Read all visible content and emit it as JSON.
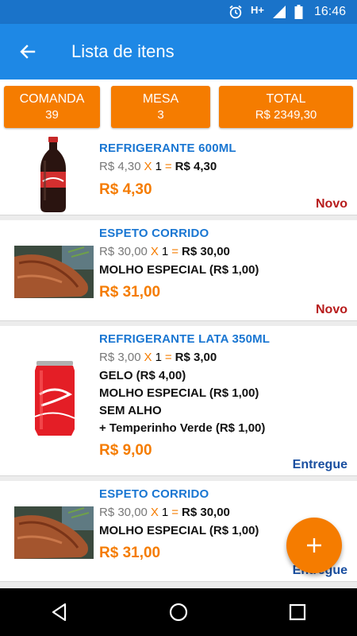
{
  "status_bar": {
    "time": "16:46",
    "network": "H+"
  },
  "app_bar": {
    "title": "Lista de itens"
  },
  "summary": {
    "comanda_label": "COMANDA",
    "comanda_value": "39",
    "mesa_label": "MESA",
    "mesa_value": "3",
    "total_label": "TOTAL",
    "total_value": "R$ 2349,30"
  },
  "items": [
    {
      "name": "REFRIGERANTE 600ML",
      "unit_price": "R$ 4,30",
      "times": "X",
      "qty": "1",
      "equals": "=",
      "line_total": "R$ 4,30",
      "extras": [],
      "price": "R$ 4,30",
      "status": "Novo",
      "image": "soda-bottle"
    },
    {
      "name": "ESPETO CORRIDO",
      "unit_price": "R$ 30,00",
      "times": "X",
      "qty": "1",
      "equals": "=",
      "line_total": "R$ 30,00",
      "extras": [
        "MOLHO ESPECIAL (R$ 1,00)"
      ],
      "price": "R$ 31,00",
      "status": "Novo",
      "image": "grilled-meat"
    },
    {
      "name": "REFRIGERANTE LATA 350ML",
      "unit_price": "R$ 3,00",
      "times": "X",
      "qty": "1",
      "equals": "=",
      "line_total": "R$ 3,00",
      "extras": [
        "GELO (R$ 4,00)",
        "MOLHO ESPECIAL (R$ 1,00)",
        "SEM ALHO",
        "+ Temperinho Verde (R$ 1,00)"
      ],
      "price": "R$ 9,00",
      "status": "Entregue",
      "image": "soda-can"
    },
    {
      "name": "ESPETO CORRIDO",
      "unit_price": "R$ 30,00",
      "times": "X",
      "qty": "1",
      "equals": "=",
      "line_total": "R$ 30,00",
      "extras": [
        "MOLHO ESPECIAL (R$ 1,00)"
      ],
      "price": "R$ 31,00",
      "status": "Entregue",
      "image": "grilled-meat"
    }
  ],
  "colors": {
    "primary": "#1e88e5",
    "status_bar": "#1a73c9",
    "accent": "#f57c00",
    "novo": "#b71c1c",
    "entregue": "#1a4fa0",
    "item_name": "#1976d2"
  },
  "icons": {
    "back": "arrow-left-icon",
    "fab": "plus-icon",
    "nav_back": "triangle-back-icon",
    "nav_home": "circle-home-icon",
    "nav_recent": "square-recent-icon"
  }
}
